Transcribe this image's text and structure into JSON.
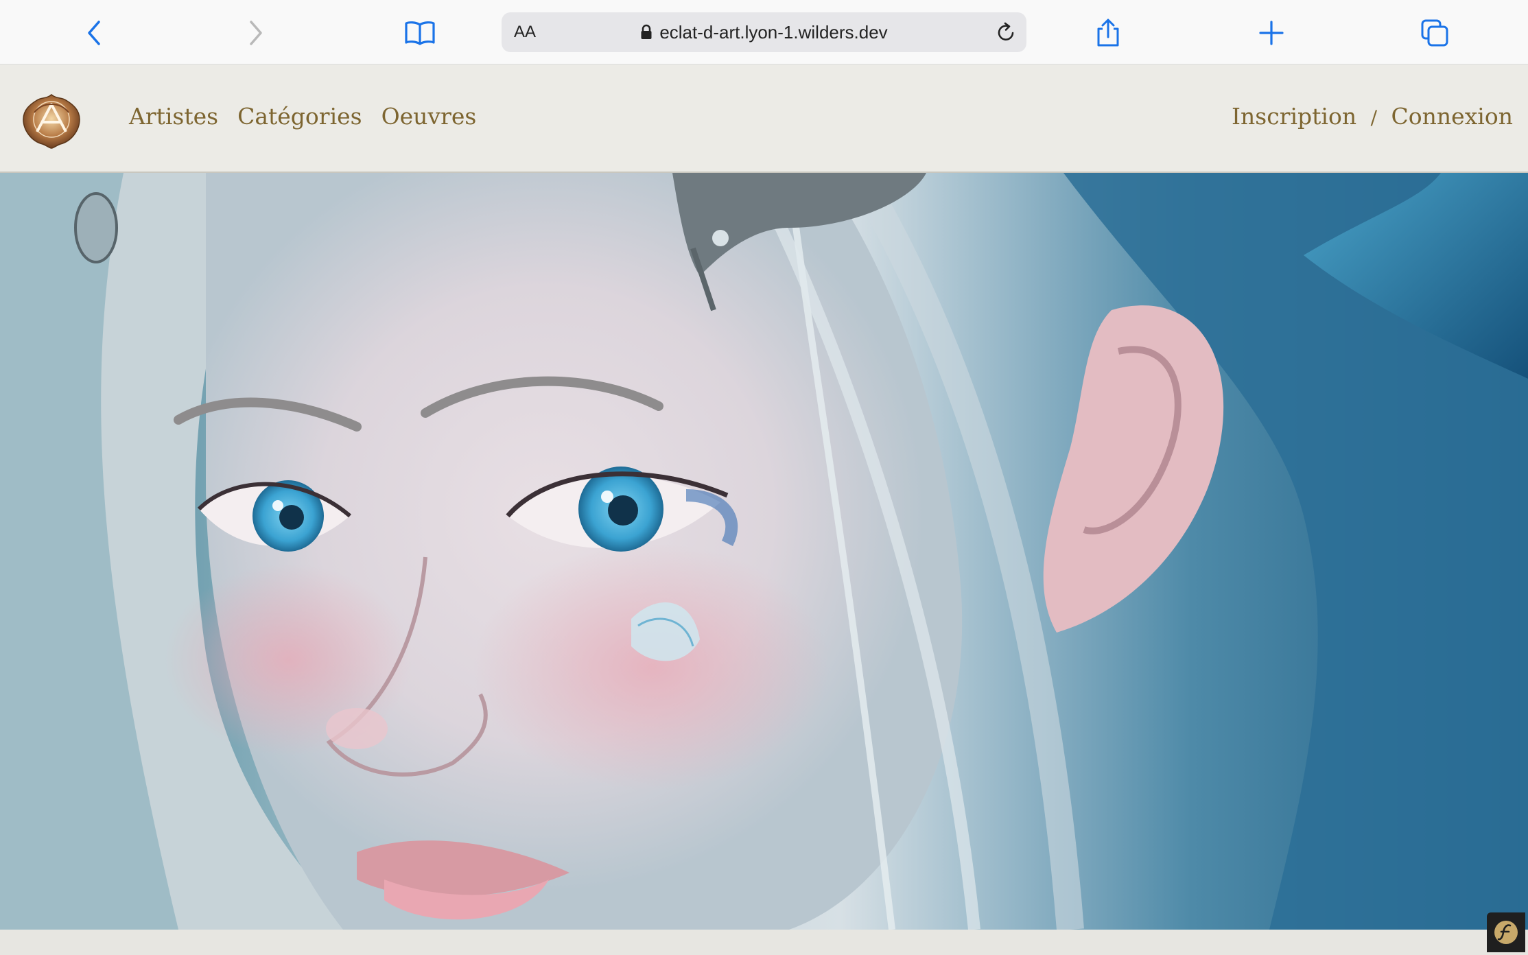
{
  "browser": {
    "text_size_label": "AA",
    "url": "eclat-d-art.lyon-1.wilders.dev",
    "icons": [
      "back-icon",
      "forward-icon",
      "bookmarks-icon",
      "lock-icon",
      "reload-icon",
      "share-icon",
      "new-tab-icon",
      "tabs-icon"
    ],
    "accent_color": "#1a73e8"
  },
  "header": {
    "logo_alt": "Éclat d'Art monogram",
    "nav": [
      "Artistes",
      "Catégories",
      "Oeuvres"
    ],
    "auth": {
      "register": "Inscription",
      "separator": "/",
      "login": "Connexion"
    },
    "text_color": "#7d6530",
    "background": "#ecebe6"
  },
  "hero": {
    "image_subject": "fantasy portrait of a pale-haired elf woman with blue eyes and blue dragon horns"
  },
  "debug_toolbar": {
    "icon": "symfony-icon"
  }
}
